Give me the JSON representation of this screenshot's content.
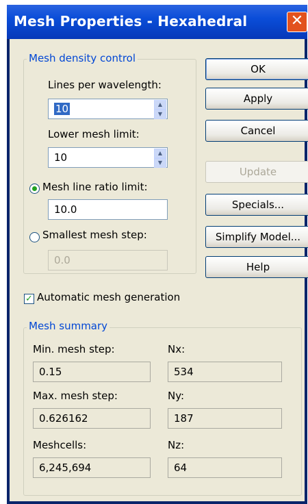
{
  "window": {
    "title": "Mesh Properties - Hexahedral",
    "close_glyph": "✕"
  },
  "density": {
    "group_label": "Mesh density control",
    "lines_label": "Lines per wavelength:",
    "lines_value": "10",
    "lower_label": "Lower mesh limit:",
    "lower_value": "10",
    "ratio_label": "Mesh line ratio limit:",
    "ratio_value": "10.0",
    "smallest_label": "Smallest mesh step:",
    "smallest_value": "0.0",
    "selected_option": "ratio"
  },
  "buttons": {
    "ok": "OK",
    "apply": "Apply",
    "cancel": "Cancel",
    "update": "Update",
    "specials": "Specials...",
    "simplify": "Simplify Model...",
    "help": "Help"
  },
  "auto_mesh": {
    "label": "Automatic mesh generation",
    "checked": true
  },
  "summary": {
    "group_label": "Mesh summary",
    "min_label": "Min. mesh step:",
    "min_value": "0.15",
    "max_label": "Max. mesh step:",
    "max_value": "0.626162",
    "cells_label": "Meshcells:",
    "cells_value": "6,245,694",
    "nx_label": "Nx:",
    "nx_value": "534",
    "ny_label": "Ny:",
    "ny_value": "187",
    "nz_label": "Nz:",
    "nz_value": "64"
  },
  "colors": {
    "titlebar": "#0a4dd8",
    "group_label": "#0046d5",
    "selection": "#316ac5",
    "window_bg": "#ece9d8"
  }
}
